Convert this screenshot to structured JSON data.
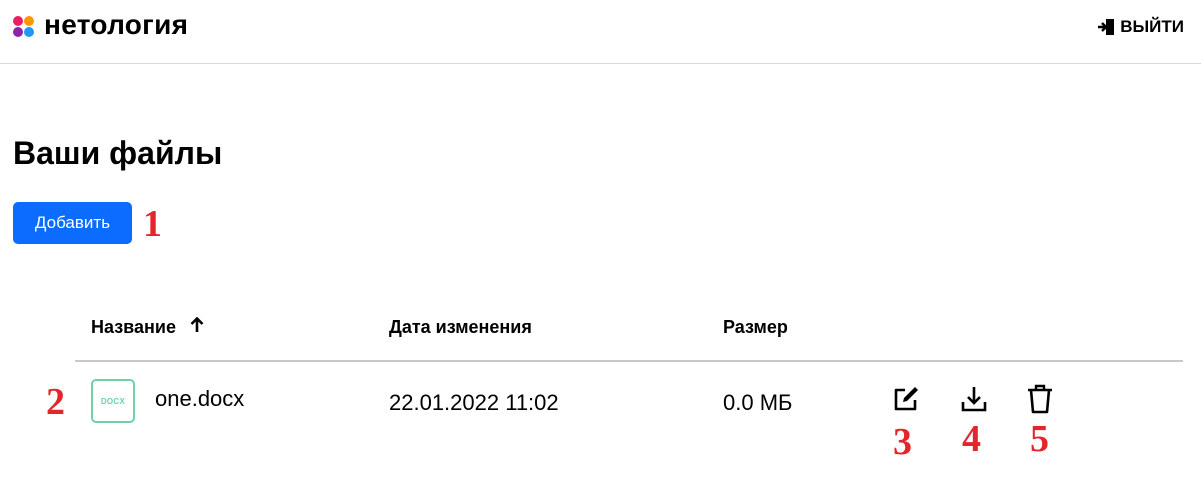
{
  "header": {
    "logo_text": "нетология",
    "logout_label": "ВЫЙТИ",
    "logo_colors": [
      "#e91e63",
      "#ff9800",
      "#2196f3",
      "#8e24aa"
    ]
  },
  "main": {
    "title": "Ваши файлы",
    "add_button_label": "Добавить",
    "accent_color": "#0b6cff"
  },
  "table": {
    "columns": {
      "name": "Название",
      "date": "Дата изменения",
      "size": "Размер"
    },
    "sort": {
      "column": "name",
      "direction": "asc",
      "icon": "arrow-up-icon"
    },
    "rows": [
      {
        "file_type": "DOCX",
        "name": "one.docx",
        "modified": "22.01.2022 11:02",
        "size": "0.0 МБ",
        "actions": [
          "edit-icon",
          "download-icon",
          "trash-icon"
        ]
      }
    ]
  },
  "annotations": {
    "add_button": "1",
    "file_row": "2",
    "edit": "3",
    "download": "4",
    "delete": "5",
    "color": "#e3262b"
  }
}
